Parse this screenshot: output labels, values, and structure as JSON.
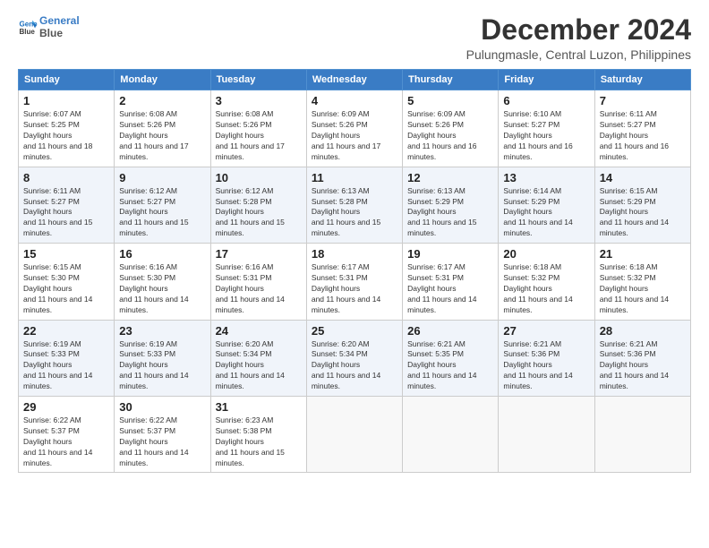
{
  "logo": {
    "line1": "General",
    "line2": "Blue"
  },
  "title": "December 2024",
  "subtitle": "Pulungmasle, Central Luzon, Philippines",
  "headers": [
    "Sunday",
    "Monday",
    "Tuesday",
    "Wednesday",
    "Thursday",
    "Friday",
    "Saturday"
  ],
  "weeks": [
    [
      {
        "day": "1",
        "sunrise": "6:07 AM",
        "sunset": "5:25 PM",
        "daylight": "11 hours and 18 minutes."
      },
      {
        "day": "2",
        "sunrise": "6:08 AM",
        "sunset": "5:26 PM",
        "daylight": "11 hours and 17 minutes."
      },
      {
        "day": "3",
        "sunrise": "6:08 AM",
        "sunset": "5:26 PM",
        "daylight": "11 hours and 17 minutes."
      },
      {
        "day": "4",
        "sunrise": "6:09 AM",
        "sunset": "5:26 PM",
        "daylight": "11 hours and 17 minutes."
      },
      {
        "day": "5",
        "sunrise": "6:09 AM",
        "sunset": "5:26 PM",
        "daylight": "11 hours and 16 minutes."
      },
      {
        "day": "6",
        "sunrise": "6:10 AM",
        "sunset": "5:27 PM",
        "daylight": "11 hours and 16 minutes."
      },
      {
        "day": "7",
        "sunrise": "6:11 AM",
        "sunset": "5:27 PM",
        "daylight": "11 hours and 16 minutes."
      }
    ],
    [
      {
        "day": "8",
        "sunrise": "6:11 AM",
        "sunset": "5:27 PM",
        "daylight": "11 hours and 15 minutes."
      },
      {
        "day": "9",
        "sunrise": "6:12 AM",
        "sunset": "5:27 PM",
        "daylight": "11 hours and 15 minutes."
      },
      {
        "day": "10",
        "sunrise": "6:12 AM",
        "sunset": "5:28 PM",
        "daylight": "11 hours and 15 minutes."
      },
      {
        "day": "11",
        "sunrise": "6:13 AM",
        "sunset": "5:28 PM",
        "daylight": "11 hours and 15 minutes."
      },
      {
        "day": "12",
        "sunrise": "6:13 AM",
        "sunset": "5:29 PM",
        "daylight": "11 hours and 15 minutes."
      },
      {
        "day": "13",
        "sunrise": "6:14 AM",
        "sunset": "5:29 PM",
        "daylight": "11 hours and 14 minutes."
      },
      {
        "day": "14",
        "sunrise": "6:15 AM",
        "sunset": "5:29 PM",
        "daylight": "11 hours and 14 minutes."
      }
    ],
    [
      {
        "day": "15",
        "sunrise": "6:15 AM",
        "sunset": "5:30 PM",
        "daylight": "11 hours and 14 minutes."
      },
      {
        "day": "16",
        "sunrise": "6:16 AM",
        "sunset": "5:30 PM",
        "daylight": "11 hours and 14 minutes."
      },
      {
        "day": "17",
        "sunrise": "6:16 AM",
        "sunset": "5:31 PM",
        "daylight": "11 hours and 14 minutes."
      },
      {
        "day": "18",
        "sunrise": "6:17 AM",
        "sunset": "5:31 PM",
        "daylight": "11 hours and 14 minutes."
      },
      {
        "day": "19",
        "sunrise": "6:17 AM",
        "sunset": "5:31 PM",
        "daylight": "11 hours and 14 minutes."
      },
      {
        "day": "20",
        "sunrise": "6:18 AM",
        "sunset": "5:32 PM",
        "daylight": "11 hours and 14 minutes."
      },
      {
        "day": "21",
        "sunrise": "6:18 AM",
        "sunset": "5:32 PM",
        "daylight": "11 hours and 14 minutes."
      }
    ],
    [
      {
        "day": "22",
        "sunrise": "6:19 AM",
        "sunset": "5:33 PM",
        "daylight": "11 hours and 14 minutes."
      },
      {
        "day": "23",
        "sunrise": "6:19 AM",
        "sunset": "5:33 PM",
        "daylight": "11 hours and 14 minutes."
      },
      {
        "day": "24",
        "sunrise": "6:20 AM",
        "sunset": "5:34 PM",
        "daylight": "11 hours and 14 minutes."
      },
      {
        "day": "25",
        "sunrise": "6:20 AM",
        "sunset": "5:34 PM",
        "daylight": "11 hours and 14 minutes."
      },
      {
        "day": "26",
        "sunrise": "6:21 AM",
        "sunset": "5:35 PM",
        "daylight": "11 hours and 14 minutes."
      },
      {
        "day": "27",
        "sunrise": "6:21 AM",
        "sunset": "5:36 PM",
        "daylight": "11 hours and 14 minutes."
      },
      {
        "day": "28",
        "sunrise": "6:21 AM",
        "sunset": "5:36 PM",
        "daylight": "11 hours and 14 minutes."
      }
    ],
    [
      {
        "day": "29",
        "sunrise": "6:22 AM",
        "sunset": "5:37 PM",
        "daylight": "11 hours and 14 minutes."
      },
      {
        "day": "30",
        "sunrise": "6:22 AM",
        "sunset": "5:37 PM",
        "daylight": "11 hours and 14 minutes."
      },
      {
        "day": "31",
        "sunrise": "6:23 AM",
        "sunset": "5:38 PM",
        "daylight": "11 hours and 15 minutes."
      },
      null,
      null,
      null,
      null
    ]
  ],
  "labels": {
    "sunrise": "Sunrise: ",
    "sunset": "Sunset: ",
    "daylight": "Daylight: "
  }
}
